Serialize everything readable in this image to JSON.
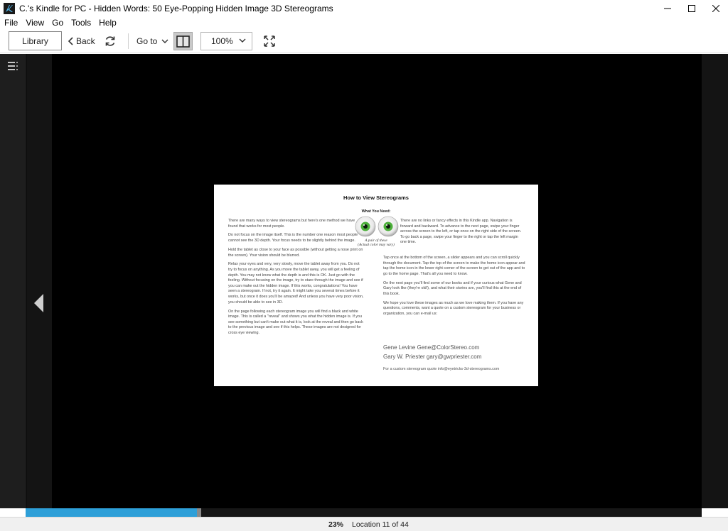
{
  "window": {
    "title": "C.'s Kindle for PC - Hidden Words: 50 Eye-Popping Hidden Image 3D Stereograms"
  },
  "menu": [
    "File",
    "View",
    "Go",
    "Tools",
    "Help"
  ],
  "toolbar": {
    "library_label": "Library",
    "back_label": "Back",
    "goto_label": "Go to",
    "zoom_value": "100%"
  },
  "page": {
    "title": "How to View Stereograms",
    "what_you_need": "What You Need:",
    "eye_caption_1": "A pair of these",
    "eye_caption_2": "(Actual color may vary)",
    "left_paragraphs": [
      "There are many ways to view stereograms but here's one method we have found that works for most people.",
      "Do not focus on the image itself. This is the number one reason most people cannot see the 3D depth. Your focus needs to be slightly behind the image.",
      "Hold the tablet as close to your face as possible (without getting a nose print on the screen). Your vision should be blurred.",
      "Relax your eyes and very, very slowly, move the tablet away from you. Do not try to focus on anything. As you move the tablet away, you will get a feeling of depth. You may not know what the depth is and this is OK. Just go with the feeling. Without focusing on the image, try to stare through the image and see if you can make out the hidden image. If this works, congratulations! You have seen a stereogram. If not, try it again. It might take you several times before it works, but once it does you'll be amazed! And unless you have very poor vision, you should be able to see in 3D.",
      "On the page following each stereogram image you will find a black and white image. This is called a \"reveal\" and shows you what the hidden image is. If you see something but can't make out what it is, look at the reveal and then go back to the previous image and see if this helps. These images are not designed for cross eye viewing."
    ],
    "right_top_paragraph": "There are no links or fancy effects in this Kindle app. Navigation is forward and backward. To advance to the next page, swipe your finger across the screen to the left, or tap once on the right side of the screen. To go back a page, swipe your finger to the right or tap the left margin one time.",
    "right_paragraphs": [
      "Tap once at the bottom of the screen, a slider appears and you can scroll quickly through the document. Tap the top of the screen to make the home icon appear and tap the home icon in the lower right corner of the screen to get out of the app and to go to the home page. That's all you need to know.",
      "On the next page you'll find some of our books and if your curious what Gene and Gary look like (they're old!), and what their stories are, you'll find this at the end of this book.",
      "We hope you love these images as much as we love making them. If you have any questions, comments, want a quote on a custom stereogram for your business or organization, you can e-mail us:"
    ],
    "contact_1": "Gene Levine Gene@ColorStereo.com",
    "contact_2": "Gary W. Priester gary@gwpriester.com",
    "quote_line": "For a custom stereogram quote info@eyetricks-3d-stereograms.com"
  },
  "progress": {
    "percent": 23,
    "percent_label": "23%",
    "location_label": "Location 11 of 44"
  },
  "colors": {
    "progress": "#2e9fd8",
    "iris": "#4caf3a",
    "reader_bg": "#000000"
  }
}
